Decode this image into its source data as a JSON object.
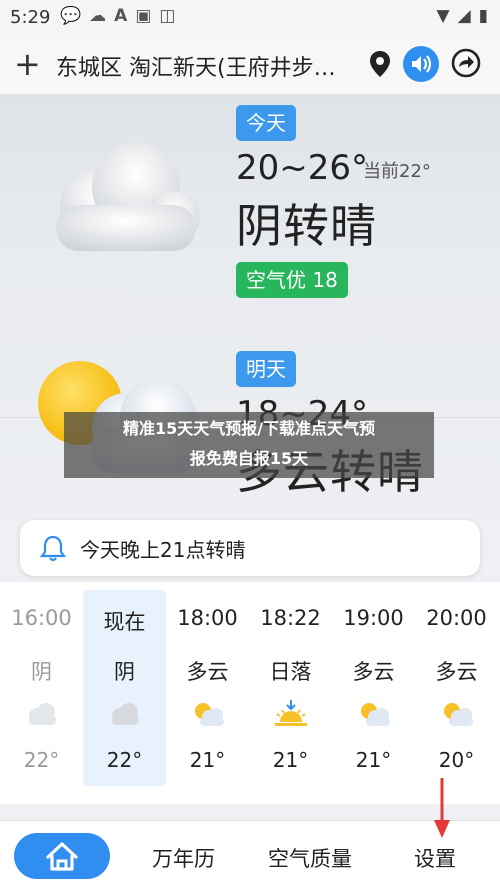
{
  "status": {
    "time": "5:29",
    "icons": [
      "chat-icon",
      "cloud-icon",
      "a-icon",
      "image-icon",
      "bag-icon"
    ]
  },
  "topbar": {
    "location": "东城区 淘汇新天(王府井步…"
  },
  "today": {
    "label": "今天",
    "temp_range": "20~26°",
    "current": "当前22°",
    "condition": "阴转晴",
    "aqi": "空气优 18"
  },
  "tomorrow": {
    "label": "明天",
    "temp_range": "18~24°",
    "condition": "多云转晴"
  },
  "banner": {
    "line1": "精准15天天气预报/下载准点天气预",
    "line2": "报免费自报15天"
  },
  "alert": {
    "text": "今天晚上21点转晴"
  },
  "hourly": [
    {
      "time": "16:00",
      "cond": "阴",
      "temp": "22°",
      "icon": "cloud-icon"
    },
    {
      "time": "现在",
      "cond": "阴",
      "temp": "22°",
      "icon": "cloud-icon"
    },
    {
      "time": "18:00",
      "cond": "多云",
      "temp": "21°",
      "icon": "partly-cloudy-icon"
    },
    {
      "time": "18:22",
      "cond": "日落",
      "temp": "21°",
      "icon": "sunset-icon"
    },
    {
      "time": "19:00",
      "cond": "多云",
      "temp": "21°",
      "icon": "partly-cloudy-icon"
    },
    {
      "time": "20:00",
      "cond": "多云",
      "temp": "20°",
      "icon": "partly-cloudy-icon"
    }
  ],
  "nav": {
    "calendar": "万年历",
    "air": "空气质量",
    "settings": "设置"
  }
}
